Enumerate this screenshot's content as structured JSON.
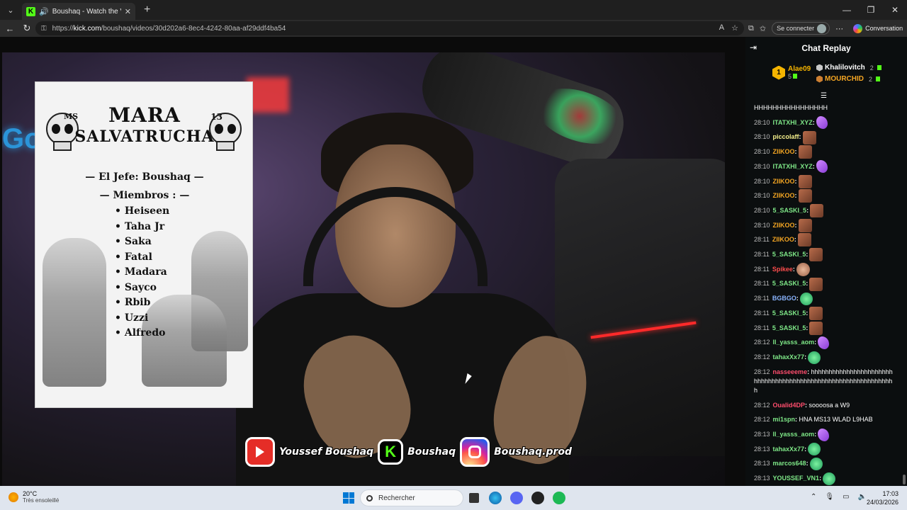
{
  "browser": {
    "tab_title": "Boushaq - Watch the VOD on",
    "tab_favicon_letter": "K",
    "url_prefix": "https://",
    "url_host": "kick.com",
    "url_path": "/boushaq/videos/30d202a6-8ec4-4242-80aa-af29ddf4ba54",
    "signin_label": "Se connecter",
    "conversation_label": "Conversation"
  },
  "video": {
    "poster": {
      "ms": "MS",
      "thirteen": "13",
      "title_line1": "MARA",
      "title_line2": "SALVATRUCHA",
      "jefe": "— El Jefe: Boushaq —",
      "miembros": "— Miembros : —",
      "members": [
        "Heiseen",
        "Taha Jr",
        "Saka",
        "Fatal",
        "Madara",
        "Sayco",
        "Rbib",
        "Uzzi",
        "Alfredo"
      ]
    },
    "social": {
      "youtube": "Youssef Boushaq",
      "kick": "Boushaq",
      "kick_letter": "K",
      "instagram": "Boushaq.prod"
    }
  },
  "chat": {
    "title": "Chat Replay",
    "leaders": {
      "first": {
        "rank": "1",
        "name": "Alae09",
        "count": "5",
        "color": "#f5b400"
      },
      "second": {
        "name": "Khalilovitch",
        "count": "2",
        "color": "#ffffff",
        "badge_color": "#c8c8c8"
      },
      "third": {
        "name": "MOURCHID",
        "count": "2",
        "color": "#f5a623",
        "badge_color": "#cd7f32"
      }
    },
    "messages": [
      {
        "time": "",
        "user": "",
        "text": "HHHHHHHHHHHHHHHH",
        "color": "#ffffff",
        "emote": ""
      },
      {
        "time": "28:10",
        "user": "ITATXHI_XYZ",
        "text": "",
        "color": "#7ee787",
        "emote": "purple"
      },
      {
        "time": "28:10",
        "user": "piccolaff",
        "text": "",
        "color": "#f5f08c",
        "emote": "face"
      },
      {
        "time": "28:10",
        "user": "ZIIKOO",
        "text": "",
        "color": "#f5a623",
        "emote": "face"
      },
      {
        "time": "28:10",
        "user": "ITATXHI_XYZ",
        "text": "",
        "color": "#7ee787",
        "emote": "purple"
      },
      {
        "time": "28:10",
        "user": "ZIIKOO",
        "text": "",
        "color": "#f5a623",
        "emote": "face"
      },
      {
        "time": "28:10",
        "user": "ZIIKOO",
        "text": "",
        "color": "#f5a623",
        "emote": "face"
      },
      {
        "time": "28:10",
        "user": "5_SASKI_5",
        "text": "",
        "color": "#7ee787",
        "emote": "face"
      },
      {
        "time": "28:10",
        "user": "ZIIKOO",
        "text": "",
        "color": "#f5a623",
        "emote": "face"
      },
      {
        "time": "28:11",
        "user": "ZIIKOO",
        "text": "",
        "color": "#f5a623",
        "emote": "face"
      },
      {
        "time": "28:11",
        "user": "5_SASKI_5",
        "text": "",
        "color": "#7ee787",
        "emote": "face"
      },
      {
        "time": "28:11",
        "user": "Spikee",
        "text": "",
        "color": "#ff4d4d",
        "emote": "skin"
      },
      {
        "time": "28:11",
        "user": "5_SASKI_5",
        "text": "",
        "color": "#7ee787",
        "emote": "face"
      },
      {
        "time": "28:11",
        "user": "BGBGO",
        "text": "",
        "color": "#8ab4ff",
        "emote": "green"
      },
      {
        "time": "28:11",
        "user": "5_SASKI_5",
        "text": "",
        "color": "#7ee787",
        "emote": "face"
      },
      {
        "time": "28:11",
        "user": "5_SASKI_5",
        "text": "",
        "color": "#7ee787",
        "emote": "face"
      },
      {
        "time": "28:12",
        "user": "ll_yasss_aom",
        "text": "",
        "color": "#7ee787",
        "emote": "purple"
      },
      {
        "time": "28:12",
        "user": "tahaxXx77",
        "text": "",
        "color": "#7ee787",
        "emote": "green"
      }
    ],
    "long_message": {
      "time": "28:12",
      "user": "nasseeeme",
      "color": "#ff4d6d",
      "text": "hhhhhhhhhhhhhhhhhhhhhhhhhhhhhhhhhhhhhhhhhhhhhhhhhhhhhhhhhhhhhhh"
    },
    "messages_after": [
      {
        "time": "28:12",
        "user": "Oualid4DP",
        "text": " soooosa a W9",
        "color": "#ff4d6d",
        "emote": ""
      },
      {
        "time": "28:12",
        "user": "mi1spn",
        "text": " HNA MS13 WLAD L9HAB",
        "color": "#7ee787",
        "emote": ""
      },
      {
        "time": "28:13",
        "user": "ll_yasss_aom",
        "text": "",
        "color": "#7ee787",
        "emote": "purple"
      },
      {
        "time": "28:13",
        "user": "tahaxXx77",
        "text": "",
        "color": "#7ee787",
        "emote": "green"
      },
      {
        "time": "28:13",
        "user": "marcos648",
        "text": "",
        "color": "#7ee787",
        "emote": "green"
      },
      {
        "time": "28:13",
        "user": "YOUSSEF_VN1",
        "text": "",
        "color": "#7ee787",
        "emote": "green"
      }
    ]
  },
  "taskbar": {
    "temp": "20°C",
    "weather_desc": "Très ensoleillé",
    "search_placeholder": "Rechercher",
    "time": "17:03",
    "date": "24/03/2026"
  }
}
